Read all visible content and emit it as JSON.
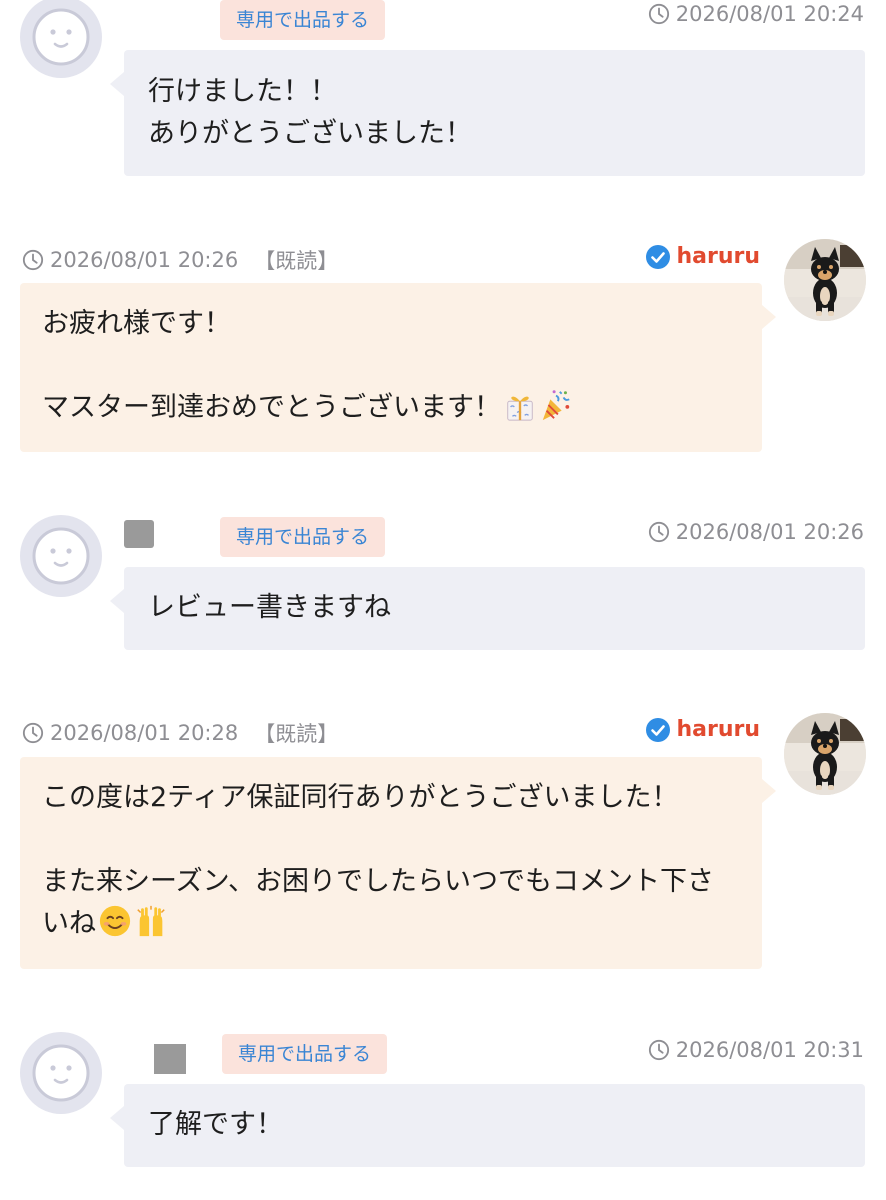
{
  "messages": [
    {
      "side": "other",
      "tag": "専用で出品する",
      "time": "2026/08/01 20:24",
      "text": "行けました！！\nありがとうございました！"
    },
    {
      "side": "self",
      "time": "2026/08/01 20:26",
      "read": "【既読】",
      "user": "haruru",
      "line1": "お疲れ様です！",
      "line2": "マスター到達おめでとうございます！",
      "emojis": [
        "gift-ribbon-emoji",
        "party-popper-emoji"
      ]
    },
    {
      "side": "other",
      "tag": "専用で出品する",
      "time": "2026/08/01 20:26",
      "text": "レビュー書きますね"
    },
    {
      "side": "self",
      "time": "2026/08/01 20:28",
      "read": "【既読】",
      "user": "haruru",
      "line1": "この度は2ティア保証同行ありがとうございました！",
      "line2": "また来シーズン、お困りでしたらいつでもコメント下さいね",
      "emojis": [
        "smiling-face-emoji",
        "raising-hands-emoji"
      ]
    },
    {
      "side": "other",
      "tag": "専用で出品する",
      "time": "2026/08/01 20:31",
      "text": "了解です！"
    }
  ],
  "icons": {
    "clock": "clock-icon",
    "verified": "verified-badge-icon",
    "default_avatar": "default-avatar-icon",
    "dog_avatar": "shiba-dog-avatar"
  },
  "colors": {
    "other_bubble": "#eeeff5",
    "self_bubble": "#fcf1e6",
    "tag_bg": "#fbe3dc",
    "tag_text": "#3a85d4",
    "username": "#e14a2f",
    "verified": "#2f8de4",
    "timestamp": "#8e8e93"
  }
}
